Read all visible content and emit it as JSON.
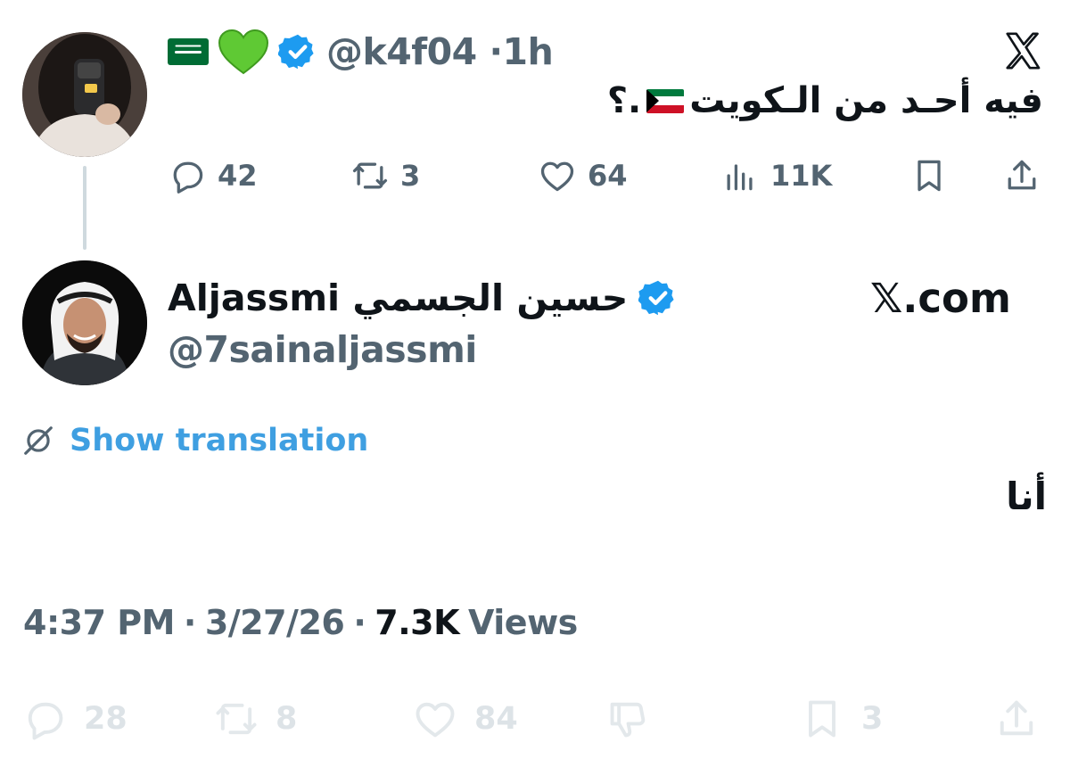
{
  "parent_tweet": {
    "handle": "@k4f04",
    "separator": "·",
    "time": "1h",
    "header_emojis": [
      "saudi-flag",
      "green-heart"
    ],
    "verified": true,
    "text": "فيه أحـد من الـكويت",
    "text_suffix": ".؟",
    "text_flag": "kuwait-flag",
    "actions": {
      "replies": "42",
      "reposts": "3",
      "likes": "64",
      "views": "11K"
    },
    "source_logo": "x-logo"
  },
  "reply_tweet": {
    "display_name": "Aljassmi حسين الجسمي",
    "handle": "@7sainaljassmi",
    "verified": true,
    "brand_label": "𝕏.com",
    "show_translation": "Show translation",
    "text": "أنا",
    "time": "4:37 PM",
    "date": "3/27/26",
    "separator": "·",
    "views_count": "7.3K",
    "views_label": "Views",
    "actions": {
      "replies": "28",
      "reposts": "8",
      "likes": "84",
      "bookmarks": "3"
    }
  },
  "colors": {
    "text_primary": "#0f1419",
    "text_secondary": "#536471",
    "link_blue": "#3f9fe1",
    "verified_blue": "#1d9bf0",
    "thread_line": "#cfd9de",
    "faded_icons": "#e3e8eb"
  }
}
